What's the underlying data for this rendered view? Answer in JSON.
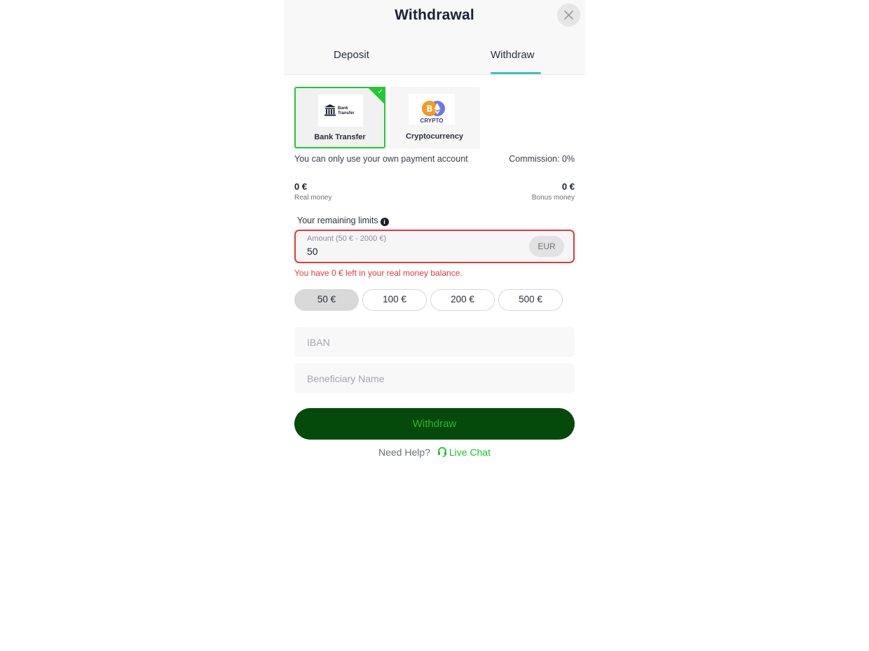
{
  "header": {
    "title": "Withdrawal",
    "close_icon": "close-icon"
  },
  "tabs": [
    {
      "label": "Deposit",
      "active": false
    },
    {
      "label": "Withdraw",
      "active": true
    }
  ],
  "accent": "#3fc2ba",
  "methods": [
    {
      "label": "Bank Transfer",
      "logo_text": [
        "Bank",
        "Transfer"
      ],
      "selected": true
    },
    {
      "label": "Cryptocurrency",
      "logo_text": "CRYPTO",
      "selected": false
    }
  ],
  "info": {
    "own_account": "You can only use your own payment account",
    "commission": "Commission: 0%"
  },
  "balances": {
    "real_value": "0 €",
    "real_label": "Real money",
    "bonus_value": "0 €",
    "bonus_label": "Bonus money"
  },
  "limits_label": "Your remaining limits",
  "amount": {
    "label": "Amount (50 € - 2000 €)",
    "value": "50",
    "currency": "EUR",
    "error": "You have 0 € left in your real money balance."
  },
  "quick_amounts": [
    "50 €",
    "100 €",
    "200 €",
    "500 €"
  ],
  "fields": {
    "iban_placeholder": "IBAN",
    "beneficiary_placeholder": "Beneficiary Name"
  },
  "withdraw_button": "Withdraw",
  "help": {
    "text": "Need Help?",
    "link": "Live Chat"
  },
  "colors": {
    "selected_border": "#23c832",
    "error": "#e23b3b",
    "button_bg": "#054a0a",
    "button_text": "#27b631"
  }
}
